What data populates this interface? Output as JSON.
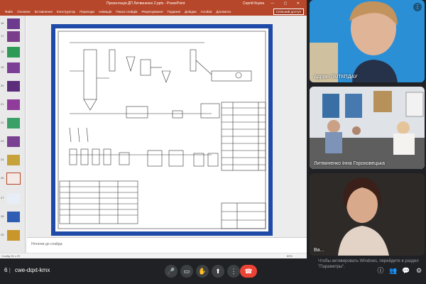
{
  "ppt": {
    "title": "Презентація ДП Литвиненко 2.pptx  -  PowerPoint",
    "user": "Сергій Кєрпа",
    "window_controls": "— ▢ ✕",
    "tabs": [
      "Файл",
      "Основне",
      "Вставлення",
      "Конструктор",
      "Переходи",
      "Анімація",
      "Показ слайдів",
      "Рецензування",
      "Подання",
      "Довідка",
      "Acrobat",
      "Допомога"
    ],
    "share_label": "Спільний доступ",
    "thumb_numbers": [
      "16",
      "17",
      "18",
      "19",
      "20",
      "21",
      "22",
      "23",
      "24",
      "25",
      "26",
      "27",
      "28",
      "29"
    ],
    "notes_placeholder": "Нотатки до слайда",
    "status_text": "Слайд 26 з 29",
    "zoom": "80%"
  },
  "participants": [
    {
      "name": "Адріан ЛМТКПДАУ"
    },
    {
      "name": "Литвиненко Інна Гороховецька"
    },
    {
      "name": "Ва..."
    }
  ],
  "meet": {
    "code": "cwe-dqxt-kmx",
    "time_prefix": "6"
  },
  "windows_notice": "Чтобы активировать Windows, перейдите в раздел \"Параметры\".",
  "colors": {
    "ppt_accent": "#b7472a",
    "slide_border": "#1f4aa8",
    "end_call": "#ea4335",
    "meet_bg": "#202124"
  }
}
